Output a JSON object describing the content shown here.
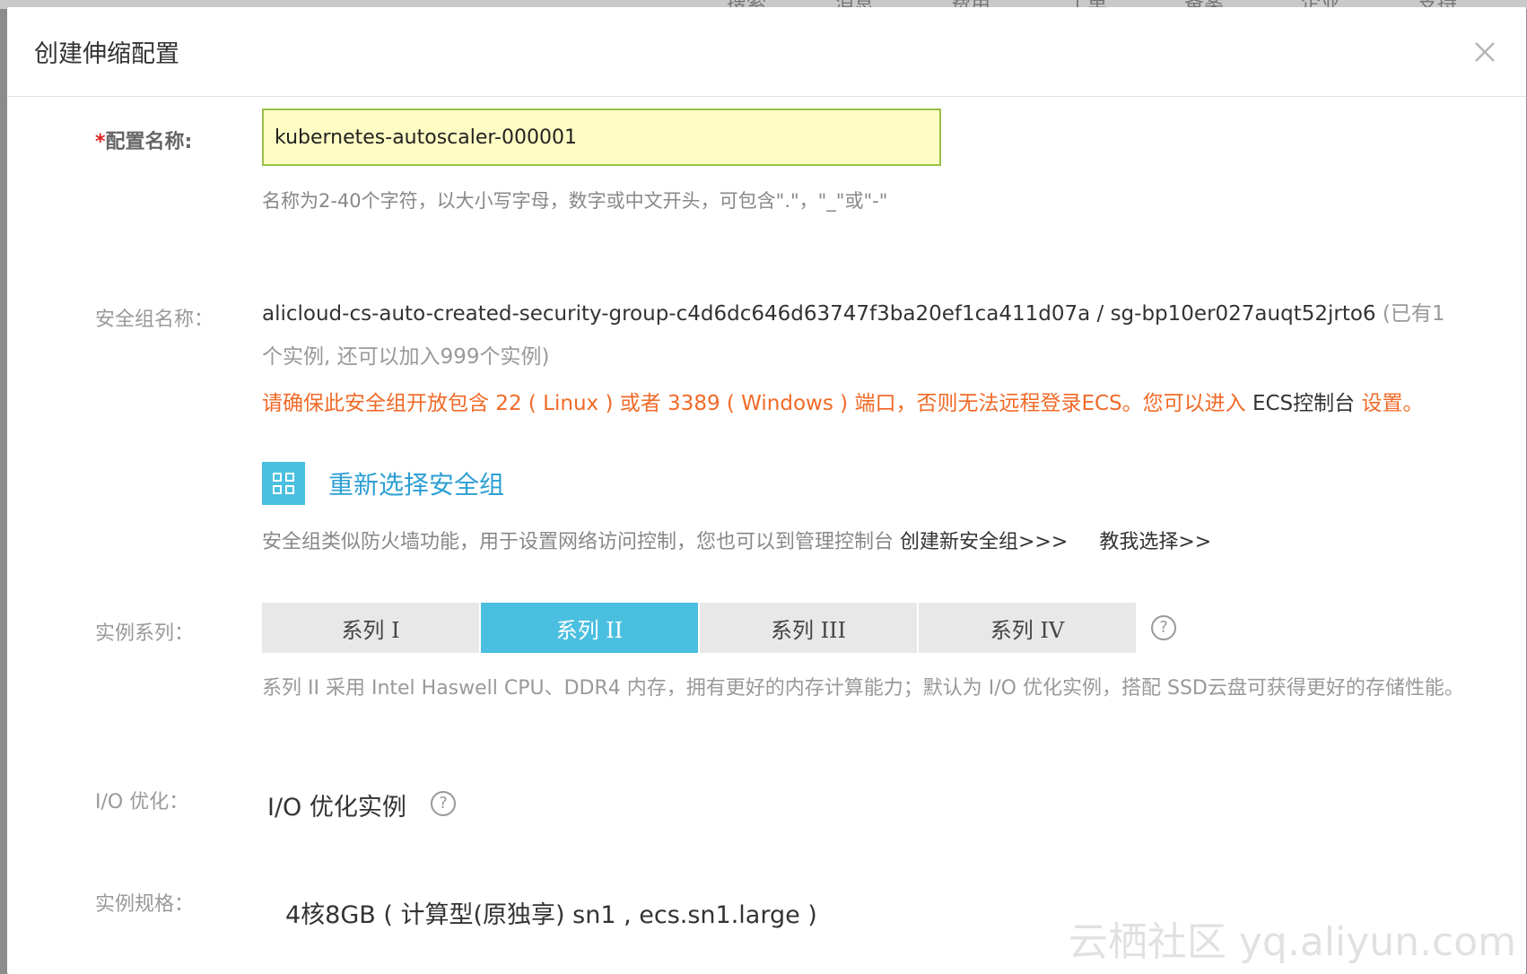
{
  "background_nav": {
    "items": [
      "搜索",
      "消息",
      "费用",
      "工单",
      "备案",
      "企业",
      "支持"
    ]
  },
  "dialog": {
    "title": "创建伸缩配置"
  },
  "config_name": {
    "required_mark": "*",
    "label": "配置名称:",
    "value": "kubernetes-autoscaler-000001",
    "hint": "名称为2-40个字符，以大小写字母，数字或中文开头，可包含\".\"，\"_\"或\"-\""
  },
  "security_group": {
    "label": "安全组名称：",
    "name": "alicloud-cs-auto-created-security-group-c4d6dc646d63747f3ba20ef1ca411d07a / sg-bp10er027auqt52jrto6",
    "count_text": "(已有1个实例, 还可以加入999个实例)",
    "warning_text": "请确保此安全组开放包含 22 ( Linux ) 或者 3389 ( Windows ) 端口，否则无法远程登录ECS。您可以进入 ",
    "warning_link": "ECS控制台",
    "warning_suffix": " 设置。",
    "reselect_label": "重新选择安全组",
    "desc_text": "安全组类似防火墙功能，用于设置网络访问控制，您也可以到管理控制台 ",
    "create_link": "创建新安全组>>>",
    "help_link": "教我选择>>"
  },
  "instance_series": {
    "label": "实例系列：",
    "tabs": [
      "系列 I",
      "系列 II",
      "系列 III",
      "系列 IV"
    ],
    "selected_index": 1,
    "description": "系列 II 采用 Intel Haswell CPU、DDR4 内存，拥有更好的内存计算能力；默认为 I/O 优化实例，搭配 SSD云盘可获得更好的存储性能。"
  },
  "io_optimization": {
    "label": "I/O 优化：",
    "value": "I/O 优化实例"
  },
  "instance_spec": {
    "label": "实例规格：",
    "value": "4核8GB ( 计算型(原独享) sn1 , ecs.sn1.large )"
  },
  "watermark": "云栖社区 yq.aliyun.com",
  "colors": {
    "accent": "#4bbfe0",
    "link_blue": "#2d9fd3",
    "warning": "#f06a27",
    "input_bg": "#fdfdc4",
    "input_border": "#9bbf45"
  }
}
